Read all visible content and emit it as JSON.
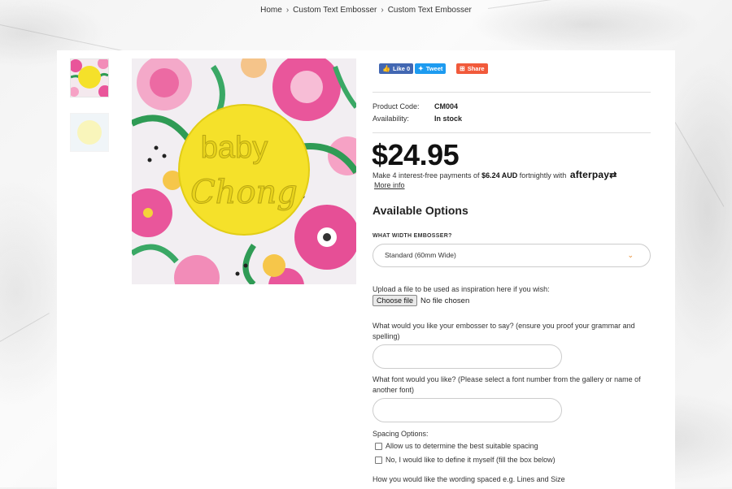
{
  "breadcrumb": {
    "items": [
      "Home",
      "Custom Text Embosser",
      "Custom Text Embosser"
    ]
  },
  "product": {
    "image_text": [
      "baby",
      "Chong"
    ],
    "share": {
      "like_label": "Like 0",
      "tweet_label": "Tweet",
      "share_label": "Share"
    },
    "code_label": "Product Code:",
    "code_value": "CM004",
    "availability_label": "Availability:",
    "availability_value": "In stock",
    "price": "$24.95",
    "afterpay": {
      "text_before": "Make 4 interest-free payments of",
      "amount": "$6.24 AUD",
      "text_after": "fortnightly with",
      "logo": "afterpay",
      "more_info": "More info"
    }
  },
  "options": {
    "title": "Available Options",
    "width_label": "WHAT WIDTH EMBOSSER?",
    "width_selected": "Standard (60mm Wide)",
    "upload_label": "Upload a file to be used as inspiration here if you wish:",
    "choose_file": "Choose file",
    "no_file": "No file chosen",
    "say_label": "What would you like your embosser to say? (ensure you proof your grammar and spelling)",
    "font_label": "What font would you like? (Please select a font number from the gallery or name of another font)",
    "spacing_label": "Spacing Options:",
    "spacing_opt1": "Allow us to determine the best suitable spacing",
    "spacing_opt2": "No, I would like to define it myself (fill the box below)",
    "wording_label": "How you would like the wording spaced e.g. Lines and Size"
  },
  "colors": {
    "accent": "#e88a2c",
    "embosser": "#f5e12a",
    "facebook": "#4267b2",
    "twitter": "#1d9bf0",
    "share": "#f15a3b"
  }
}
